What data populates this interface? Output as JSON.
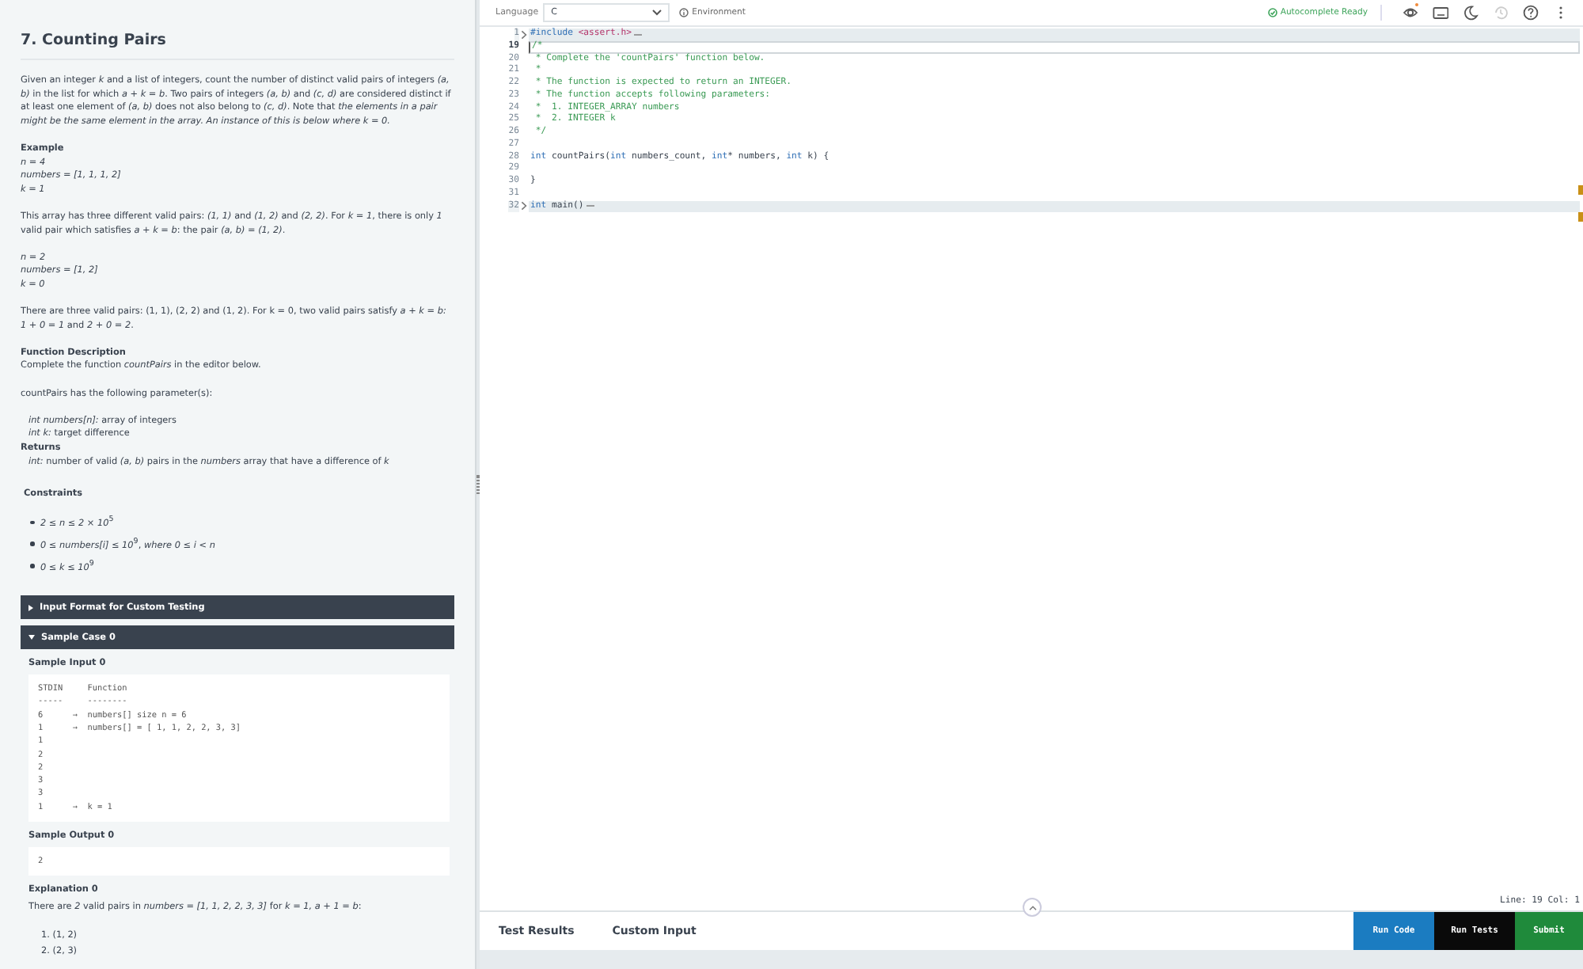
{
  "problem": {
    "title": "7. Counting Pairs",
    "blocks": [
      {
        "kind": "para",
        "text": "Given an integer *k* and a list of integers, count the number of distinct valid pairs of integers *(a, b)* in the list for which *a + k = b*. Two pairs of integers *(a, b)* and *(c, d)* are considered distinct if at least one element of *(a, b)* does not also belong to *(c, d)*. Note that *the elements in a pair might be the same element in the array. An instance of this is below where k = 0.*"
      },
      {
        "kind": "heading",
        "text": "Example"
      },
      {
        "kind": "lines",
        "items": [
          "*n = 4*",
          "*numbers = [1, 1, 1, 2]*",
          "*k = 1*"
        ]
      },
      {
        "kind": "para",
        "text": "This array has three different valid pairs: *(1, 1)* and *(1, 2)* and *(2, 2)*. For *k = 1*, there is only *1* valid pair which satisfies *a + k = b*: the pair *(a, b) = (1, 2)*."
      },
      {
        "kind": "lines",
        "items": [
          "*n = 2*",
          "*numbers = [1, 2]*",
          "*k = 0*"
        ]
      },
      {
        "kind": "para",
        "text": "There are three valid pairs: (1, 1), (2, 2) and (1, 2). For k = 0, two valid pairs satisfy *a + k = b: 1 + 0 = 1* and *2 + 0 = 2*."
      },
      {
        "kind": "heading",
        "text": "Function Description"
      },
      {
        "kind": "lines",
        "items": [
          "Complete the function *countPairs* in the editor below."
        ]
      },
      {
        "kind": "para",
        "text": "countPairs has the following parameter(s):"
      },
      {
        "kind": "indented",
        "items": [
          "*int numbers[n]:*  array of integers",
          "*int k:* target difference"
        ]
      },
      {
        "kind": "heading",
        "text": "Returns"
      },
      {
        "kind": "indented",
        "items": [
          "*int:* number of valid *(a, b)* pairs in the *numbers* array that have a difference of *k*"
        ]
      },
      {
        "kind": "section",
        "text": "Constraints"
      },
      {
        "kind": "bullets",
        "items": [
          "*2 ≤ n ≤ 2 × 10*$^{5}$",
          "*0 ≤ numbers[i] ≤ 10*$^{9}$, *where 0 ≤ i < n*",
          "*0 ≤ k ≤ 10*$^{9}$"
        ]
      },
      {
        "kind": "collapsible",
        "title": "Input Format for Custom Testing",
        "expanded": false
      },
      {
        "kind": "collapsible",
        "title": "Sample Case 0",
        "expanded": true,
        "children": [
          {
            "kind": "subheading",
            "text": "Sample Input 0"
          },
          {
            "kind": "code",
            "lines": [
              "STDIN     Function",
              "-----     --------",
              "6      →  numbers[] size n = 6",
              "1      →  numbers[] = [ 1, 1, 2, 2, 3, 3]",
              "1",
              "2",
              "2",
              "3",
              "3",
              "1      →  k = 1"
            ]
          },
          {
            "kind": "subheading",
            "text": "Sample Output 0"
          },
          {
            "kind": "code",
            "lines": [
              "2"
            ]
          },
          {
            "kind": "subheading",
            "text": "Explanation 0"
          },
          {
            "kind": "lines",
            "items": [
              "There are *2* valid pairs in *numbers = [1, 1, 2, 2, 3, 3]* for *k = 1, a + 1 = b*:"
            ]
          },
          {
            "kind": "ordered",
            "items": [
              "1. (1, 2)",
              "2. (2, 3)"
            ]
          }
        ]
      }
    ]
  },
  "editor": {
    "language_label": "Language",
    "language": "C",
    "environment": "Environment",
    "autocomplete": "Autocomplete Ready",
    "tools": [
      {
        "kind": "eye",
        "disabled": false,
        "badge": true
      },
      {
        "kind": "keyboard",
        "disabled": false
      },
      {
        "kind": "moon",
        "disabled": false
      },
      {
        "kind": "history",
        "disabled": true
      },
      {
        "kind": "help",
        "disabled": false
      },
      {
        "kind": "more",
        "disabled": false
      }
    ],
    "lines": [
      {
        "number": "1",
        "folded": true,
        "current": false,
        "segments": [
          {
            "kind": "keyword",
            "text": "#include"
          },
          {
            "kind": "string",
            "text": "<assert.h>"
          }
        ]
      },
      {
        "number": "19",
        "folded": false,
        "current": true,
        "segments": [
          {
            "kind": "comment",
            "text": "/*"
          }
        ]
      },
      {
        "number": "20",
        "folded": false,
        "current": false,
        "segments": [
          {
            "kind": "comment",
            "text": " * Complete the 'countPairs' function below."
          }
        ]
      },
      {
        "number": "21",
        "folded": false,
        "current": false,
        "segments": [
          {
            "kind": "comment",
            "text": " *"
          }
        ]
      },
      {
        "number": "22",
        "folded": false,
        "current": false,
        "segments": [
          {
            "kind": "comment",
            "text": " * The function is expected to return an INTEGER."
          }
        ]
      },
      {
        "number": "23",
        "folded": false,
        "current": false,
        "segments": [
          {
            "kind": "comment",
            "text": " * The function accepts following parameters:"
          }
        ]
      },
      {
        "number": "24",
        "folded": false,
        "current": false,
        "segments": [
          {
            "kind": "comment",
            "text": " *  1. INTEGER_ARRAY numbers"
          }
        ]
      },
      {
        "number": "25",
        "folded": false,
        "current": false,
        "segments": [
          {
            "kind": "comment",
            "text": " *  2. INTEGER k"
          }
        ]
      },
      {
        "number": "26",
        "folded": false,
        "current": false,
        "segments": [
          {
            "kind": "comment",
            "text": " */"
          }
        ]
      },
      {
        "number": "27",
        "folded": false,
        "current": false
      },
      {
        "number": "28",
        "folded": false,
        "current": false,
        "segments": [
          {
            "kind": "keyword",
            "text": "int"
          },
          {
            "kind": "plain",
            "text": " countPairs("
          },
          {
            "kind": "keyword",
            "text": "int"
          },
          {
            "kind": "plain",
            "text": " numbers_count, "
          },
          {
            "kind": "keyword",
            "text": "int"
          },
          {
            "kind": "plain",
            "text": "* numbers, "
          },
          {
            "kind": "keyword",
            "text": "int"
          },
          {
            "kind": "plain",
            "text": " k) {"
          }
        ]
      },
      {
        "number": "29",
        "folded": false,
        "current": false
      },
      {
        "number": "30",
        "folded": false,
        "current": false,
        "segments": [
          {
            "kind": "plain",
            "text": "}"
          }
        ]
      },
      {
        "number": "31",
        "folded": false,
        "current": false
      },
      {
        "number": "32",
        "folded": true,
        "current": false,
        "segments": [
          {
            "kind": "keyword",
            "text": "int"
          },
          {
            "kind": "plain",
            "text": " main()"
          }
        ]
      }
    ],
    "cursor_status": "Line: 19 Col: 1"
  },
  "bottom": {
    "tabs": [
      {
        "label": "Test Results",
        "selected": false
      },
      {
        "label": "Custom Input",
        "selected": false
      }
    ],
    "buttons": [
      {
        "label": "Run Code",
        "color": "#1b7cc1"
      },
      {
        "label": "Run Tests",
        "color": "#0a0a0a"
      },
      {
        "label": "Submit",
        "color": "#1f8a3b"
      }
    ]
  }
}
